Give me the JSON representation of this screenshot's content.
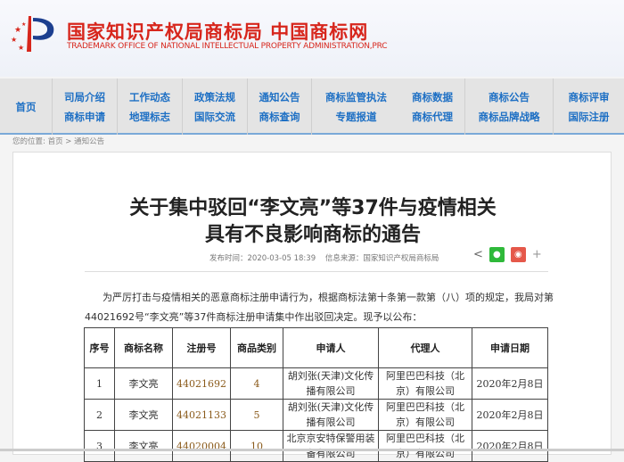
{
  "header": {
    "title_cn": "国家知识产权局商标局 中国商标网",
    "title_en": "TRADEMARK OFFICE OF NATIONAL INTELLECTUAL PROPERTY ADMINISTRATION,PRC"
  },
  "nav": {
    "home": "首页",
    "columns": [
      [
        "司局介绍",
        "商标申请"
      ],
      [
        "工作动态",
        "地理标志"
      ],
      [
        "政策法规",
        "国际交流"
      ],
      [
        "通知公告",
        "商标查询"
      ],
      [
        "商标监管执法",
        "专题报道"
      ],
      [
        "商标数据",
        "商标代理"
      ],
      [
        "商标公告",
        "商标品牌战略"
      ],
      [
        "商标评审",
        "国际注册"
      ]
    ]
  },
  "breadcrumb": {
    "label": "您的位置:",
    "home": "首页",
    "sep": ">",
    "current": "通知公告"
  },
  "article": {
    "title_line1": "关于集中驳回“李文亮”等37件与疫情相关",
    "title_line2": "具有不良影响商标的通告",
    "publish_time": "发布时间：2020-03-05 18:39",
    "source": "信息来源：国家知识产权局商标局",
    "share_more": "+",
    "para1": "为严厉打击与疫情相关的恶意商标注册申请行为，根据商标法第十条第一款第（八）项的规定，我局对第",
    "para2": "44021692号“李文亮”等37件商标注册申请集中作出驳回决定。现予以公布："
  },
  "table": {
    "headers": [
      "序号",
      "商标名称",
      "注册号",
      "商品类别",
      "申请人",
      "代理人",
      "申请日期"
    ],
    "rows": [
      [
        "1",
        "李文亮",
        "44021692",
        "4",
        "胡刘张(天津)文化传播有限公司",
        "阿里巴巴科技（北京）有限公司",
        "2020年2月8日"
      ],
      [
        "2",
        "李文亮",
        "44021133",
        "5",
        "胡刘张(天津)文化传播有限公司",
        "阿里巴巴科技（北京）有限公司",
        "2020年2月8日"
      ],
      [
        "3",
        "李文亮",
        "44020004",
        "10",
        "北京京安特保警用装备有限公司",
        "阿里巴巴科技（北京）有限公司",
        "2020年2月8日"
      ]
    ]
  },
  "colors": {
    "brand_red": "#d7261c",
    "nav_blue": "#1d6fc4",
    "wechat": "#2fb93a",
    "weibo": "#e5584a"
  }
}
